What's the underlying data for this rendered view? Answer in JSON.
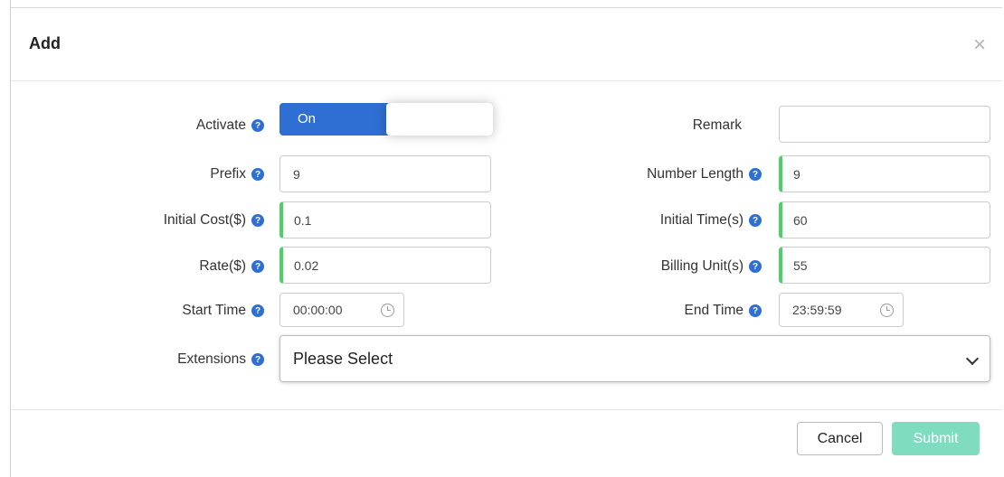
{
  "dialog": {
    "title": "Add"
  },
  "form": {
    "activate": {
      "label": "Activate",
      "toggle_text": "On"
    },
    "remark": {
      "label": "Remark",
      "value": ""
    },
    "prefix": {
      "label": "Prefix",
      "value": "9"
    },
    "number_length": {
      "label": "Number Length",
      "value": "9"
    },
    "initial_cost": {
      "label": "Initial Cost($)",
      "value": "0.1"
    },
    "initial_time": {
      "label": "Initial Time(s)",
      "value": "60"
    },
    "rate": {
      "label": "Rate($)",
      "value": "0.02"
    },
    "billing_unit": {
      "label": "Billing Unit(s)",
      "value": "55"
    },
    "start_time": {
      "label": "Start Time",
      "value": "00:00:00"
    },
    "end_time": {
      "label": "End Time",
      "value": "23:59:59"
    },
    "extensions": {
      "label": "Extensions",
      "placeholder": "Please Select"
    }
  },
  "buttons": {
    "cancel": "Cancel",
    "submit": "Submit"
  },
  "icons": {
    "help": "question-circle-icon",
    "close": "close-icon",
    "clock": "clock-icon",
    "chevron": "chevron-down-icon"
  },
  "colors": {
    "accent": "#2f6fd4",
    "valid": "#4cd16a",
    "submit": "#7fdcbf"
  }
}
